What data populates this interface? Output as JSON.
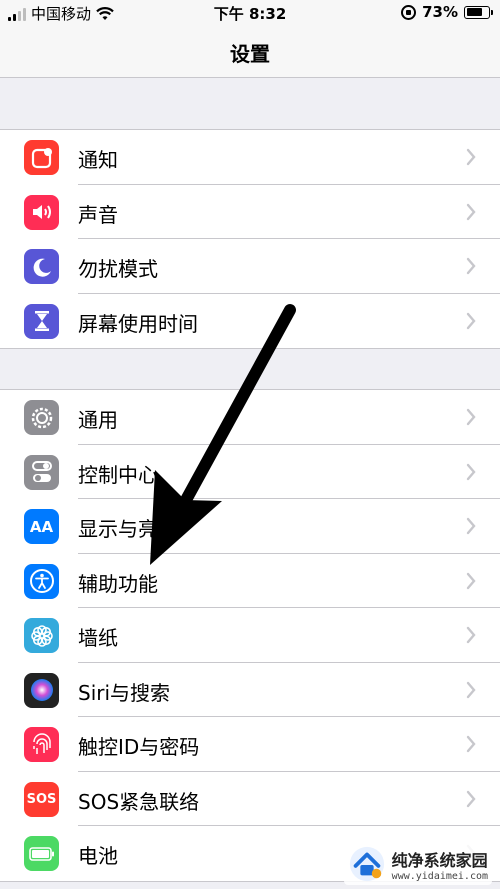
{
  "status_bar": {
    "carrier": "中国移动",
    "time": "下午 8:32",
    "battery_percent": "73%",
    "battery_level": 0.73
  },
  "nav": {
    "title": "设置"
  },
  "groups": [
    {
      "items": [
        {
          "label": "通知",
          "icon": "notifications-icon",
          "color": "#ff3b30"
        },
        {
          "label": "声音",
          "icon": "sound-icon",
          "color": "#ff2d55"
        },
        {
          "label": "勿扰模式",
          "icon": "do-not-disturb-icon",
          "color": "#5856d6"
        },
        {
          "label": "屏幕使用时间",
          "icon": "screen-time-icon",
          "color": "#5856d6"
        }
      ]
    },
    {
      "items": [
        {
          "label": "通用",
          "icon": "gear-icon",
          "color": "#8e8e93"
        },
        {
          "label": "控制中心",
          "icon": "control-center-icon",
          "color": "#8e8e93"
        },
        {
          "label": "显示与亮度",
          "icon": "display-brightness-icon",
          "color": "#007aff"
        },
        {
          "label": "辅助功能",
          "icon": "accessibility-icon",
          "color": "#007aff"
        },
        {
          "label": "墙纸",
          "icon": "wallpaper-icon",
          "color": "#34aadc"
        },
        {
          "label": "Siri与搜索",
          "icon": "siri-icon",
          "color": "#222222"
        },
        {
          "label": "触控ID与密码",
          "icon": "touch-id-icon",
          "color": "#ff2d55"
        },
        {
          "label": "SOS紧急联络",
          "icon": "sos-icon",
          "color": "#ff3b30"
        },
        {
          "label": "电池",
          "icon": "battery-icon",
          "color": "#4cd964"
        }
      ]
    }
  ],
  "icon_texts": {
    "display": "AA",
    "sos": "SOS"
  },
  "watermark": {
    "title": "纯净系统家园",
    "url": "www.yidaimei.com"
  }
}
